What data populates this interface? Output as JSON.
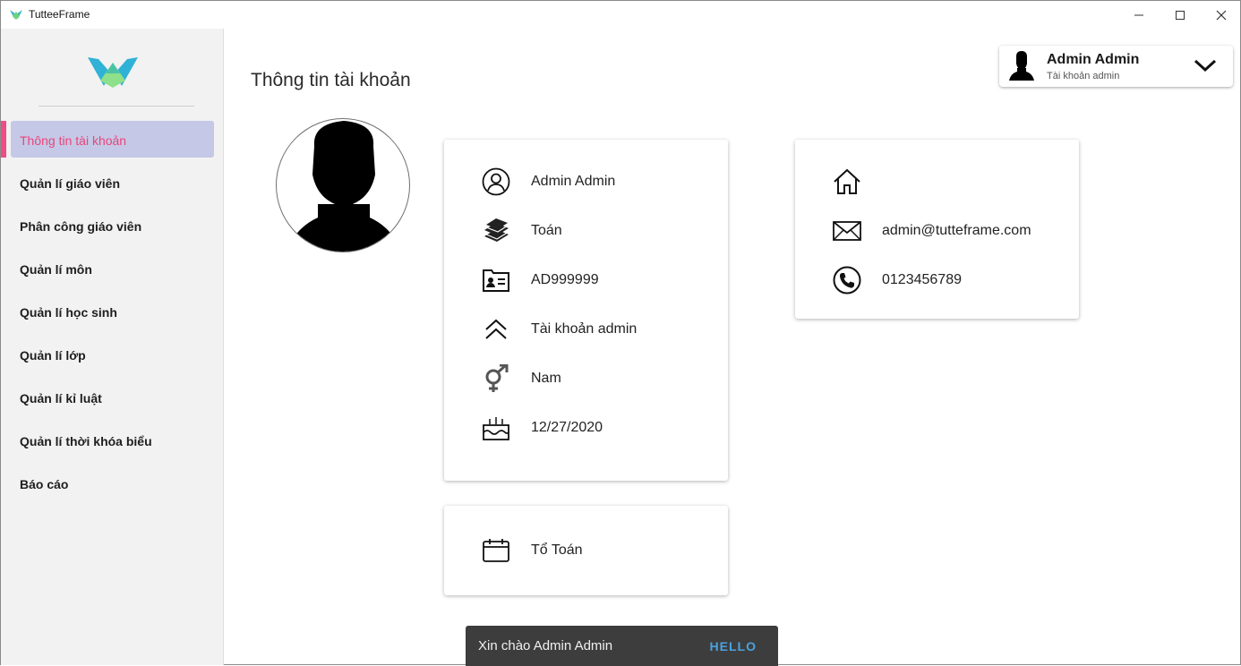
{
  "window": {
    "title": "TutteeFrame"
  },
  "sidebar": {
    "items": [
      {
        "label": "Thông tin tài khoản",
        "active": true
      },
      {
        "label": "Quản lí giáo viên"
      },
      {
        "label": "Phân công giáo viên"
      },
      {
        "label": "Quản lí môn"
      },
      {
        "label": "Quản lí học sinh"
      },
      {
        "label": "Quản lí lớp"
      },
      {
        "label": "Quản lí kỉ luật"
      },
      {
        "label": "Quản lí thời khóa biểu"
      },
      {
        "label": "Báo cáo"
      }
    ]
  },
  "header": {
    "page_title": "Thông tin tài khoản",
    "user": {
      "name": "Admin Admin",
      "role": "Tài khoản admin"
    }
  },
  "info_card": {
    "name": "Admin Admin",
    "subject": "Toán",
    "id": "AD999999",
    "position": "Tài khoản admin",
    "gender": "Nam",
    "birthday": "12/27/2020"
  },
  "group_card": {
    "group": "Tổ Toán"
  },
  "contact_card": {
    "address": "",
    "email": "admin@tutteframe.com",
    "phone": "0123456789"
  },
  "snackbar": {
    "message": "Xin chào Admin Admin",
    "action": "HELLO"
  },
  "colors": {
    "accent": "#ee4d85",
    "active_bg": "#c5c8e6",
    "snack_action": "#4aa3df"
  }
}
